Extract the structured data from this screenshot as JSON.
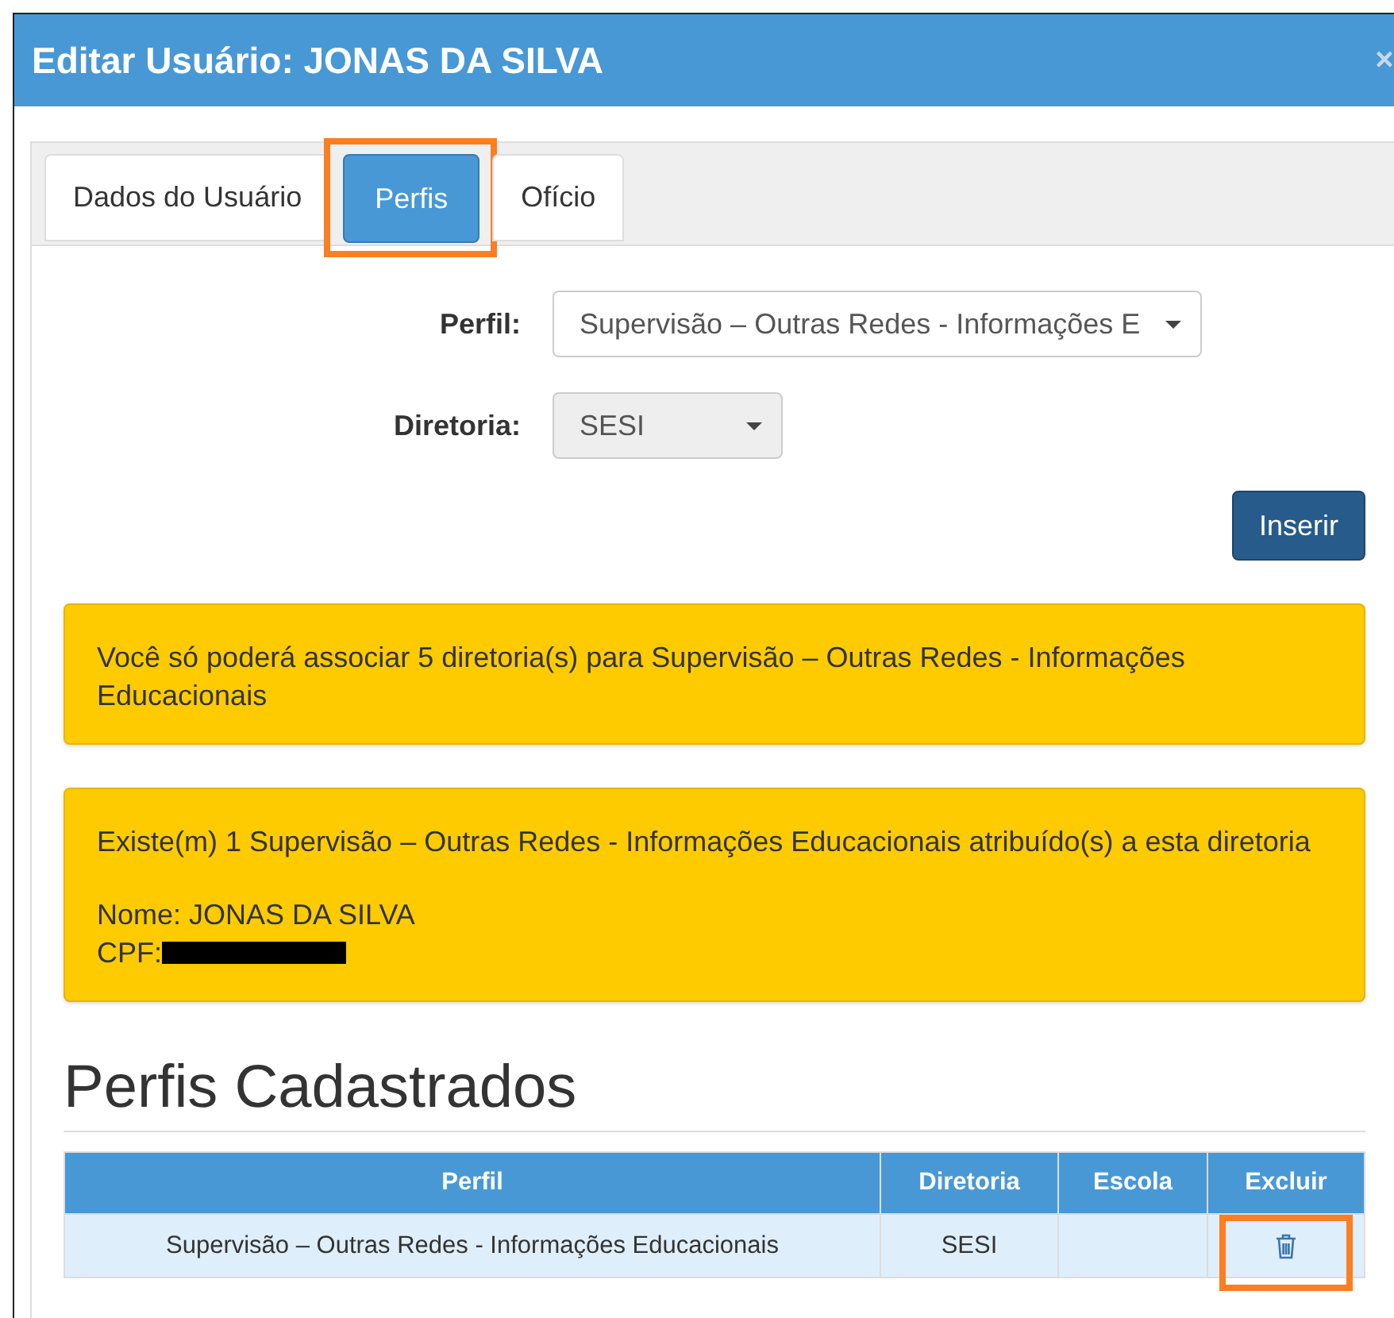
{
  "dialog": {
    "title": "Editar Usuário: JONAS DA SILVA",
    "close": "×"
  },
  "tabs": [
    {
      "label": "Dados do Usuário",
      "selected": false,
      "highlighted": false
    },
    {
      "label": "Perfis",
      "selected": true,
      "highlighted": true
    },
    {
      "label": "Ofício",
      "selected": false,
      "highlighted": false
    }
  ],
  "form": {
    "fields": [
      {
        "label": "Perfil:",
        "value": "Supervisão – Outras Redes - Informações E",
        "disabled": false
      },
      {
        "label": "Diretoria:",
        "value": "SESI",
        "disabled": true
      }
    ],
    "submit": "Inserir"
  },
  "alerts": [
    {
      "paragraphs": [
        [
          {
            "text": "Você só poderá associar 5 diretoria(s) para Supervisão – Outras Redes - Informações Educacionais",
            "redacted": false
          }
        ]
      ]
    },
    {
      "paragraphs": [
        [
          {
            "text": "Existe(m) 1 Supervisão – Outras Redes - Informações Educacionais atribuído(s) a esta diretoria",
            "redacted": false
          }
        ],
        [
          {
            "text": "Nome: JONAS DA SILVA",
            "redacted": false
          },
          {
            "text": "CPF:",
            "redacted": true
          }
        ]
      ]
    }
  ],
  "section": {
    "title": "Perfis Cadastrados"
  },
  "table": {
    "columns": [
      "Perfil",
      "Diretoria",
      "Escola",
      "Excluir"
    ],
    "rows": [
      {
        "perfil": "Supervisão – Outras Redes - Informações Educacionais",
        "diretoria": "SESI",
        "delete_highlighted": true
      }
    ]
  }
}
